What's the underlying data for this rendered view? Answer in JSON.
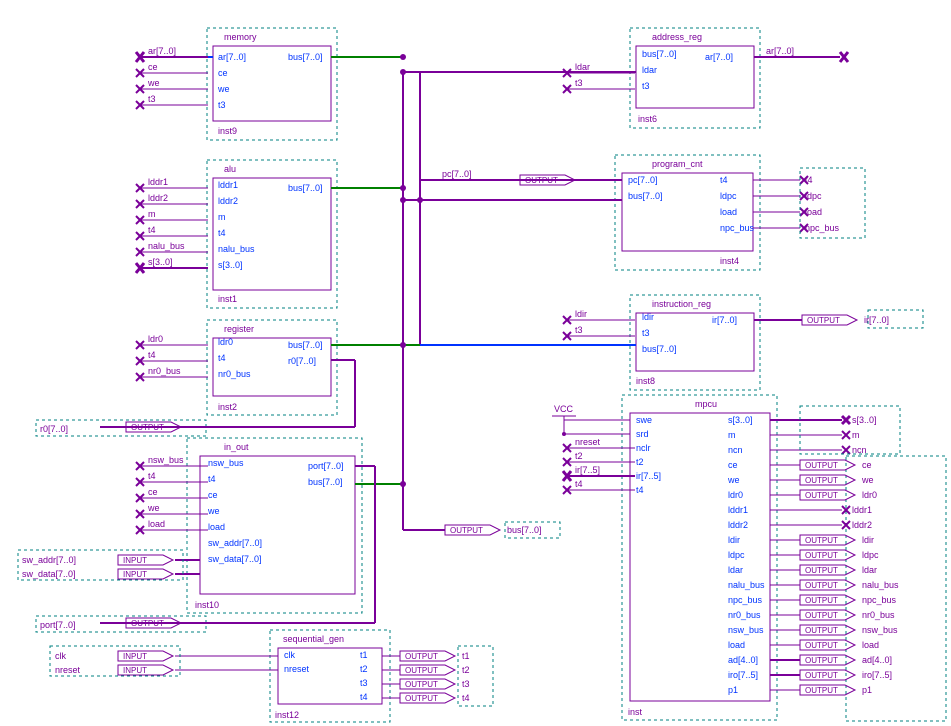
{
  "blocks": {
    "memory": {
      "title": "memory",
      "inst": "inst9",
      "pinsL": [
        "ar[7..0]",
        "ce",
        "we",
        "t3"
      ],
      "pinsR": [
        "bus[7..0]"
      ]
    },
    "alu": {
      "title": "alu",
      "inst": "inst1",
      "pinsL": [
        "lddr1",
        "lddr2",
        "m",
        "t4",
        "nalu_bus",
        "s[3..0]"
      ],
      "pinsR": [
        "bus[7..0]"
      ]
    },
    "register": {
      "title": "register",
      "inst": "inst2",
      "pinsL": [
        "ldr0",
        "t4",
        "nr0_bus"
      ],
      "pinsR": [
        "bus[7..0]",
        "r0[7..0]"
      ]
    },
    "in_out": {
      "title": "in_out",
      "inst": "inst10",
      "pinsL": [
        "nsw_bus",
        "t4",
        "ce",
        "we",
        "load",
        "sw_addr[7..0]",
        "sw_data[7..0]"
      ],
      "pinsR": [
        "port[7..0]",
        "bus[7..0]"
      ]
    },
    "seq_gen": {
      "title": "sequential_gen",
      "inst": "inst12",
      "pinsL": [
        "clk",
        "nreset"
      ],
      "pinsR": [
        "t1",
        "t2",
        "t3",
        "t4"
      ]
    },
    "addr_reg": {
      "title": "address_reg",
      "inst": "inst6",
      "pinsL": [
        "bus[7..0]",
        "ldar",
        "t3"
      ],
      "pinsR": [
        "ar[7..0]"
      ]
    },
    "prog_cnt": {
      "title": "program_cnt",
      "inst": "inst4",
      "pinsL": [
        "pc[7..0]",
        "bus[7..0]"
      ],
      "pinsR": [
        "t4",
        "ldpc",
        "load",
        "npc_bus"
      ]
    },
    "ins_reg": {
      "title": "instruction_reg",
      "inst": "inst8",
      "pinsL": [
        "ldir",
        "t3",
        "bus[7..0]"
      ],
      "pinsR": [
        "ir[7..0]"
      ]
    },
    "mpcu": {
      "title": "mpcu",
      "inst": "inst",
      "pinsL": [
        "swe",
        "srd",
        "nclr",
        "t2",
        "ir[7..5]",
        "t4"
      ],
      "pinsR": [
        "s[3..0]",
        "m",
        "ncn",
        "ce",
        "we",
        "ldr0",
        "lddr1",
        "lddr2",
        "ldir",
        "ldpc",
        "ldar",
        "nalu_bus",
        "npc_bus",
        "nr0_bus",
        "nsw_bus",
        "load",
        "ad[4..0]",
        "iro[7..5]",
        "p1"
      ]
    }
  },
  "extSignals": {
    "memL": [
      "ar[7..0]",
      "ce",
      "we",
      "t3"
    ],
    "aluL": [
      "lddr1",
      "lddr2",
      "m",
      "t4",
      "nalu_bus",
      "s[3..0]"
    ],
    "regL": [
      "ldr0",
      "t4",
      "nr0_bus"
    ],
    "ioL": [
      "nsw_bus",
      "t4",
      "ce",
      "we",
      "load"
    ],
    "ioInputs": [
      "sw_addr[7..0]",
      "sw_data[7..0]"
    ],
    "seqL": [
      "clk",
      "nreset"
    ],
    "addrL": [
      "ldar",
      "t3"
    ],
    "addrR": [
      "ar[7..0]"
    ],
    "progR": [
      "t4",
      "ldpc",
      "load",
      "npc_bus"
    ],
    "irL": [
      "ldir",
      "t3"
    ],
    "mpcuL": [
      "nreset",
      "t2",
      "ir[7..5]",
      "t4"
    ],
    "mpcuR": [
      "s[3..0]",
      "m",
      "ncn",
      "ce",
      "we",
      "ldr0",
      "lddr1",
      "lddr2",
      "ldir",
      "ldpc",
      "ldar",
      "nalu_bus",
      "npc_bus",
      "nr0_bus",
      "nsw_bus",
      "load",
      "ad[4..0]",
      "iro[7..5]",
      "p1"
    ]
  },
  "outputPins": {
    "r0": "r0[7..0]",
    "port": "port[7..0]",
    "bus": "bus[7..0]",
    "pc": "pc[7..0]",
    "ir": "ir[7..0]",
    "t1": "t1",
    "t2": "t2",
    "t3": "t3",
    "t4": "t4"
  },
  "labels": {
    "input": "INPUT",
    "output": "OUTPUT",
    "vcc": "VCC"
  }
}
